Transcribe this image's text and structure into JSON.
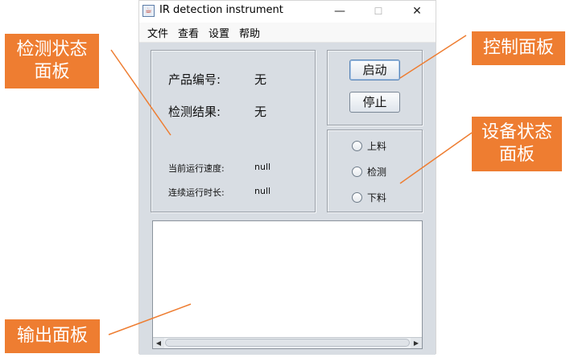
{
  "window": {
    "title": "IR detection instrument",
    "icon": "java-cup-icon",
    "controls": {
      "minimize": "—",
      "maximize": "☐",
      "close": "✕"
    }
  },
  "menu": [
    "文件",
    "查看",
    "设置",
    "帮助"
  ],
  "status_panel": {
    "product_label": "产品编号:",
    "product_value": "无",
    "result_label": "检测结果:",
    "result_value": "无",
    "speed_label": "当前运行速度:",
    "speed_value": "null",
    "duration_label": "连续运行时长:",
    "duration_value": "null"
  },
  "control_panel": {
    "start": "启动",
    "stop": "停止"
  },
  "device_panel": {
    "options": [
      "上料",
      "检测",
      "下料"
    ]
  },
  "output_panel": {
    "text": ""
  },
  "annotations": {
    "status": [
      "检测状态",
      "面板"
    ],
    "control": [
      "控制面板"
    ],
    "device": [
      "设备状态",
      "面板"
    ],
    "output": [
      "输出面板"
    ]
  },
  "colors": {
    "callout": "#ee7d31",
    "panel_bg": "#d8dde3"
  }
}
